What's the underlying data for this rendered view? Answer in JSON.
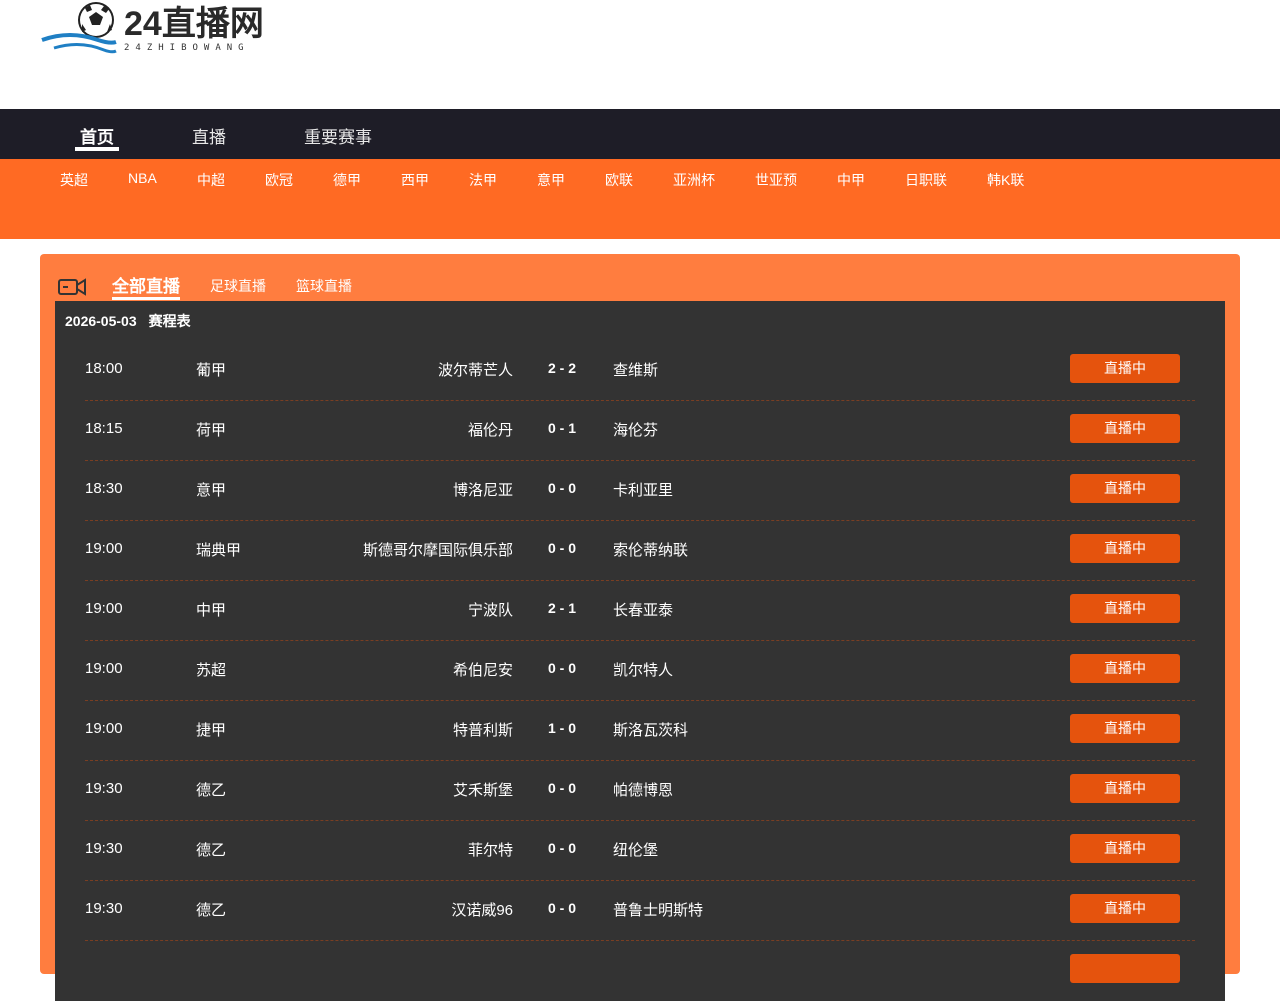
{
  "logo": {
    "title": "24直播网",
    "subtitle": "24ZHIBOWANG"
  },
  "mainnav": {
    "items": [
      "首页",
      "直播",
      "重要赛事"
    ],
    "active": 0
  },
  "subnav": {
    "items": [
      "英超",
      "NBA",
      "中超",
      "欧冠",
      "德甲",
      "西甲",
      "法甲",
      "意甲",
      "欧联",
      "亚洲杯",
      "世亚预",
      "中甲",
      "日职联",
      "韩K联"
    ]
  },
  "tabs": {
    "items": [
      "全部直播",
      "足球直播",
      "篮球直播"
    ],
    "active": 0
  },
  "schedule": {
    "date": "2026-05-03",
    "label": "赛程表",
    "matches": [
      {
        "time": "18:00",
        "league": "葡甲",
        "home": "波尔蒂芒人",
        "score": "2 - 2",
        "away": "查维斯",
        "status": "直播中"
      },
      {
        "time": "18:15",
        "league": "荷甲",
        "home": "福伦丹",
        "score": "0 - 1",
        "away": "海伦芬",
        "status": "直播中"
      },
      {
        "time": "18:30",
        "league": "意甲",
        "home": "博洛尼亚",
        "score": "0 - 0",
        "away": "卡利亚里",
        "status": "直播中"
      },
      {
        "time": "19:00",
        "league": "瑞典甲",
        "home": "斯德哥尔摩国际俱乐部",
        "score": "0 - 0",
        "away": "索伦蒂纳联",
        "status": "直播中"
      },
      {
        "time": "19:00",
        "league": "中甲",
        "home": "宁波队",
        "score": "2 - 1",
        "away": "长春亚泰",
        "status": "直播中"
      },
      {
        "time": "19:00",
        "league": "苏超",
        "home": "希伯尼安",
        "score": "0 - 0",
        "away": "凯尔特人",
        "status": "直播中"
      },
      {
        "time": "19:00",
        "league": "捷甲",
        "home": "特普利斯",
        "score": "1 - 0",
        "away": "斯洛瓦茨科",
        "status": "直播中"
      },
      {
        "time": "19:30",
        "league": "德乙",
        "home": "艾禾斯堡",
        "score": "0 - 0",
        "away": "帕德博恩",
        "status": "直播中"
      },
      {
        "time": "19:30",
        "league": "德乙",
        "home": "菲尔特",
        "score": "0 - 0",
        "away": "纽伦堡",
        "status": "直播中"
      },
      {
        "time": "19:30",
        "league": "德乙",
        "home": "汉诺威96",
        "score": "0 - 0",
        "away": "普鲁士明斯特",
        "status": "直播中"
      },
      {
        "time": "",
        "league": "",
        "home": "",
        "score": "",
        "away": "",
        "status": ""
      }
    ]
  },
  "colors": {
    "nav_bg": "#1e1d27",
    "orange": "#ff6a23",
    "panel": "#ff7d3f",
    "board": "#333333",
    "button": "#e5530d"
  }
}
